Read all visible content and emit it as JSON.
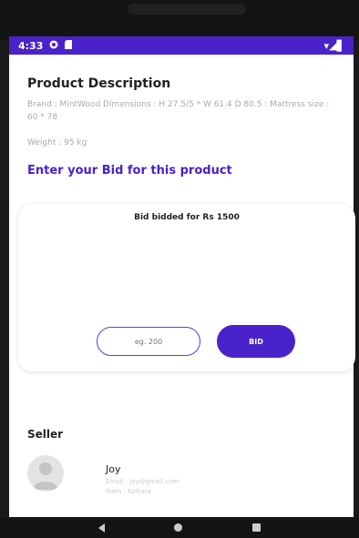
{
  "status_bar": {
    "time": "4:33",
    "signal": "▾◢▋"
  },
  "product": {
    "section_title": "Product Description",
    "description": "Brand : MintWood Dimensions : H 27.5/5 * W 61.4 D 80.5 : Mattress size : 60 * 78",
    "weight": "Weight : 95 kg"
  },
  "bid": {
    "prompt": "Enter your Bid for this product",
    "status": "Bid bidded for Rs 1500",
    "input_placeholder": "eg. 200",
    "button_label": "BID"
  },
  "seller": {
    "section_title": "Seller",
    "name": "Joy",
    "email": "Email : joy@gmail.com",
    "location": "From : Kolkata"
  },
  "colors": {
    "accent": "#4a22c9"
  }
}
